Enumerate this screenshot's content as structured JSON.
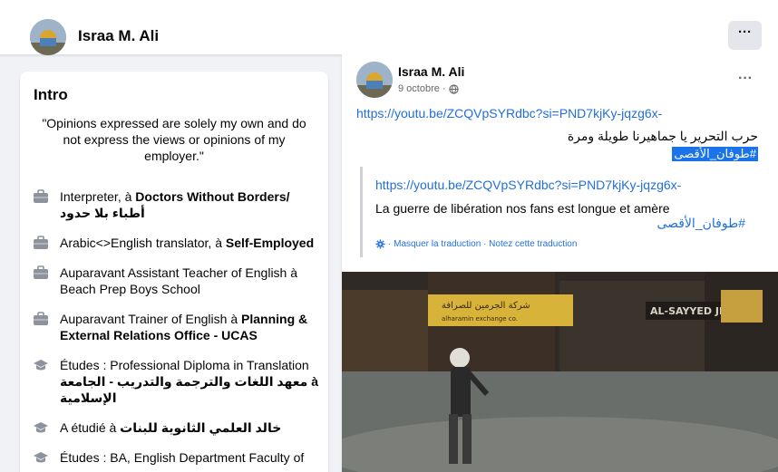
{
  "header": {
    "name": "Israa M. Ali",
    "more_label": "···"
  },
  "intro": {
    "title": "Intro",
    "bio": "\"Opinions expressed are solely my own and do not express the views or opinions of my employer.\"",
    "items": [
      {
        "icon": "briefcase-icon",
        "prefix": "Interpreter, à ",
        "bold": "Doctors Without Borders/",
        "arabic": "أطباء بلا حدود"
      },
      {
        "icon": "briefcase-icon",
        "prefix": "Arabic<>English translator, à ",
        "bold": "Self-Employed",
        "arabic": ""
      },
      {
        "icon": "briefcase-icon",
        "prefix": "Auparavant Assistant Teacher of English à ",
        "bold": "Beach Prep Boys School",
        "arabic": ""
      },
      {
        "icon": "briefcase-icon",
        "prefix": "Auparavant Trainer of English à ",
        "bold": "Planning & External Relations Office - UCAS",
        "arabic": ""
      },
      {
        "icon": "graduation-cap-icon",
        "prefix": "Études : Professional Diploma in Translation ",
        "bold": "معهد اللغات والترجمة والتدريب - الجامعة",
        "arabic": "à الإسلامية"
      },
      {
        "icon": "graduation-cap-icon",
        "prefix": "A étudié à ",
        "bold": "خالد العلمي الثانوية للبنات",
        "arabic": ""
      },
      {
        "icon": "graduation-cap-icon",
        "prefix": "Études : BA, English Department Faculty of",
        "bold": "",
        "arabic": ""
      }
    ]
  },
  "post": {
    "author": "Israa M. Ali",
    "date": "9 octobre ·",
    "more_label": "···",
    "link": "https://youtu.be/ZCQVpSYRdbc?si=PND7kjKy-jqzg6x-",
    "arabic_text": "حرب التحرير يا جماهيرنا طويلة ومرة",
    "hashtag": "#طوفان_الأقصى",
    "translation": {
      "link": "https://youtu.be/ZCQVpSYRdbc?si=PND7kjKy-jqzg6x-",
      "text": "La guerre de libération nos fans est longue et amère",
      "hashtag": "#طوفان_الأقصى",
      "actions": "· Masquer la traduction · Notez cette traduction"
    }
  },
  "video": {
    "sign1": "شركة الجرمين للصرافة",
    "sign2": "alharamin exchange co.",
    "sign3": "AL-SAYYED JEWEL"
  }
}
